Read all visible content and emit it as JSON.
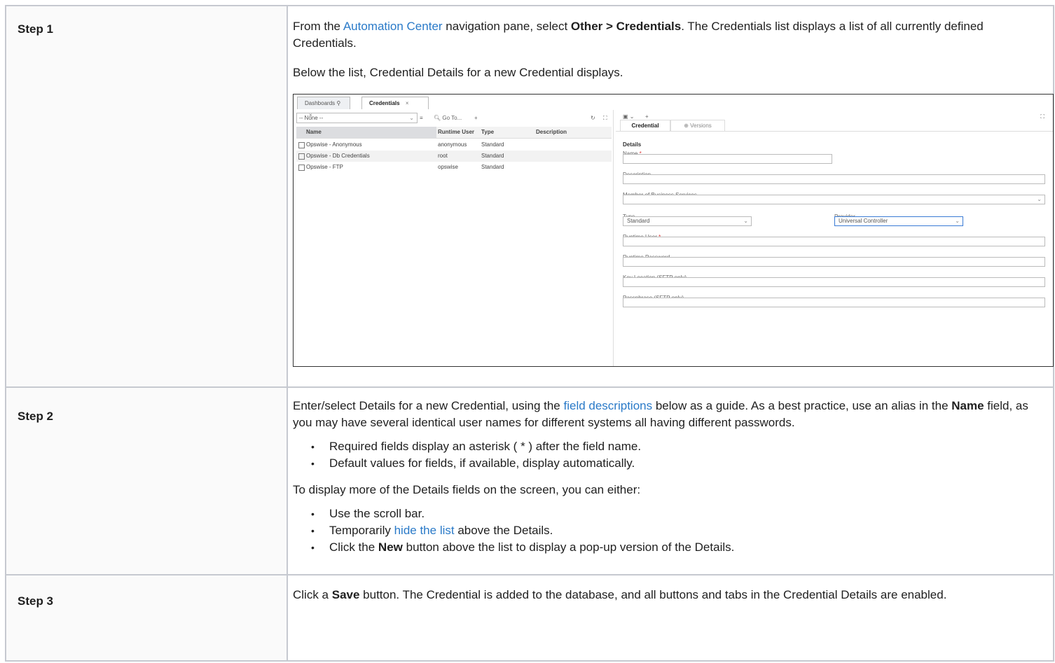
{
  "steps": [
    {
      "label": "Step 1",
      "p1": {
        "t1": "From the ",
        "link": "Automation Center",
        "t2": " navigation pane, select ",
        "bold": "Other > Credentials",
        "t3": ". The Credentials list displays a list of all currently defined Credentials."
      },
      "p2": "Below the list, Credential Details for a new Credential displays."
    },
    {
      "label": "Step 2",
      "p1": {
        "t1": "Enter/select Details for a new Credential, using the ",
        "link": "field descriptions",
        "t2": " below as a guide. As a best practice, use an alias in the ",
        "bold": "Name",
        "t3": " field, as you may have several identical user names for different systems all having different passwords."
      },
      "bullets1": [
        "Required fields display an asterisk ( * ) after the field name.",
        "Default values for fields, if available, display automatically."
      ],
      "p2": "To display more of the Details fields on the screen, you can either:",
      "b1": "Use the scroll bar.",
      "b2": {
        "t1": "Temporarily ",
        "link": "hide the list",
        "t2": " above the Details."
      },
      "b3": {
        "t1": "Click the ",
        "bold": "New",
        "t2": " button above the list to display a pop-up version of the Details."
      }
    },
    {
      "label": "Step 3",
      "p1": {
        "t1": "Click a ",
        "bold": "Save",
        "t2": " button. The Credential is added to the database, and all buttons and tabs in the Credential Details are enabled."
      }
    }
  ],
  "screenshot": {
    "tabs": [
      {
        "label": "Dashboards",
        "pin": "⚲",
        "close": "×"
      },
      {
        "label": "Credentials",
        "close": "×"
      }
    ],
    "filter_value": "-- None --",
    "goto_label": "Go To...",
    "plus": "+",
    "columns": [
      "Name",
      "Runtime User",
      "Type",
      "Description"
    ],
    "rows": [
      {
        "name": "Opswise - Anonymous",
        "user": "anonymous",
        "type": "Standard"
      },
      {
        "name": "Opswise - Db Credentials",
        "user": "root",
        "type": "Standard"
      },
      {
        "name": "Opswise - FTP",
        "user": "opswise",
        "type": "Standard"
      }
    ],
    "detail_tabs": [
      "Credential",
      "Versions"
    ],
    "section": "Details",
    "fields": {
      "name": "Name",
      "description": "Description",
      "member": "Member of Business Services",
      "type": "Type",
      "type_value": "Standard",
      "provider": "Provider",
      "provider_value": "Universal Controller",
      "runtime_user": "Runtime User",
      "runtime_password": "Runtime Password",
      "key_location": "Key Location (SFTP only)",
      "passphrase": "Passphrase (SFTP only)"
    },
    "required_mark": "*"
  }
}
